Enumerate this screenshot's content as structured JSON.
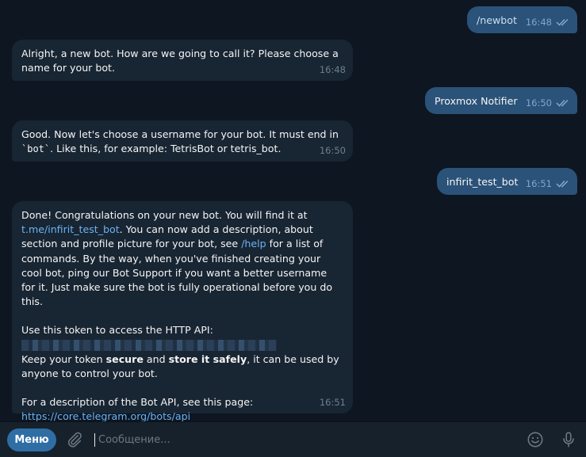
{
  "messages": [
    {
      "text": "/newbot",
      "time": "16:48"
    },
    {
      "text": "Alright, a new bot. How are we going to call it? Please choose a name for your bot.",
      "time": "16:48"
    },
    {
      "text": "Proxmox Notifier",
      "time": "16:50"
    },
    {
      "parts": {
        "before": "Good. Now let's choose a username for your bot. It must end in ",
        "code": "`bot`",
        "after": ". Like this, for example: TetrisBot or tetris_bot."
      },
      "time": "16:50"
    },
    {
      "text": "infirit_test_bot",
      "time": "16:51"
    },
    {
      "time": "16:51",
      "p1_a": "Done! Congratulations on your new bot. You will find it at ",
      "p1_link": "t.me/infirit_test_bot",
      "p1_b": ". You can now add a description, about section and profile picture for your bot, see ",
      "p1_help": "/help",
      "p1_c": " for a list of commands. By the way, when you've finished creating your cool bot, ping our Bot Support if you want a better username for it. Just make sure the bot is fully operational before you do this.",
      "p2": "Use this token to access the HTTP API:",
      "p3_a": "Keep your token ",
      "p3_b1": "secure",
      "p3_and": " and ",
      "p3_b2": "store it safely",
      "p3_c": ", it can be used by anyone to control your bot.",
      "p4": "For a description of the Bot API, see this page:",
      "p4_link": "https://core.telegram.org/bots/api"
    }
  ],
  "composer": {
    "menu_label": "Меню",
    "placeholder": "Сообщение..."
  },
  "colors": {
    "background": "#0e1621",
    "incoming_bubble": "#182533",
    "outgoing_bubble": "#2b5278",
    "link": "#6ab3f3",
    "menu_button": "#2f6ea5"
  },
  "icons": [
    "double-check-icon",
    "paperclip-icon",
    "emoji-icon",
    "microphone-icon"
  ]
}
